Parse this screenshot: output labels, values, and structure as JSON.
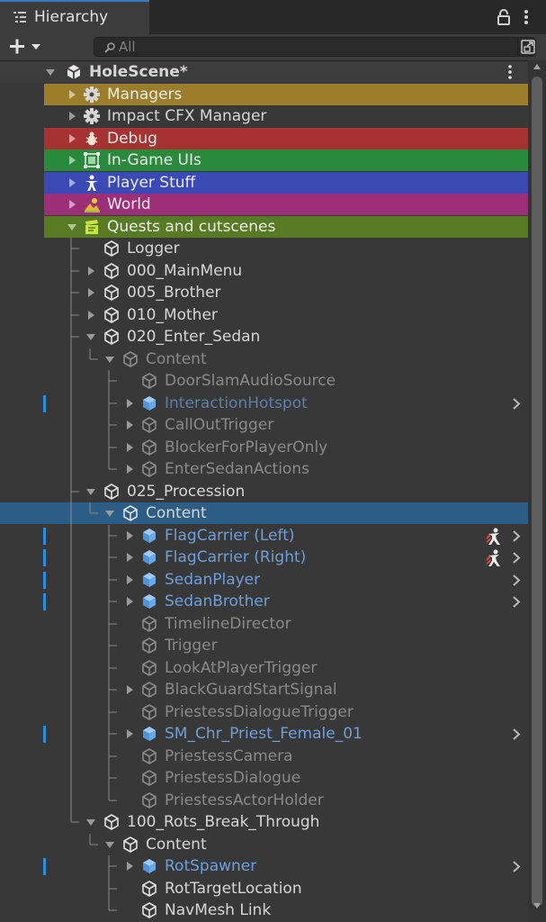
{
  "tab": {
    "title": "Hierarchy",
    "icon": "hierarchy-list-icon"
  },
  "toolbar": {
    "create_icon": "plus-icon",
    "search_placeholder": "All",
    "search_value": ""
  },
  "colors": {
    "selection": "#2c5d87",
    "managers": "#9c7d29",
    "debug": "#a63232",
    "ingame": "#2a8a3c",
    "player": "#3a49b4",
    "world": "#9d2e78",
    "quests": "#577a22",
    "prefab_text": "#6e9fdc",
    "inactive_text": "#8a8a8a",
    "prefab_bar": "#2c8ed8"
  },
  "rows": [
    {
      "name": "HoleScene*",
      "depth": 0,
      "expanded": true,
      "kind": "scene",
      "bold": true
    },
    {
      "name": "Managers",
      "depth": 1,
      "expanded": false,
      "icon": "gear-icon",
      "color": "managers"
    },
    {
      "name": "Impact CFX Manager",
      "depth": 1,
      "expanded": false,
      "icon": "gear-icon"
    },
    {
      "name": "Debug",
      "depth": 1,
      "expanded": false,
      "icon": "bug-icon",
      "color": "debug"
    },
    {
      "name": "In-Game UIs",
      "depth": 1,
      "expanded": false,
      "icon": "ui-frame-icon",
      "color": "ingame"
    },
    {
      "name": "Player Stuff",
      "depth": 1,
      "expanded": false,
      "icon": "person-icon",
      "color": "player"
    },
    {
      "name": "World",
      "depth": 1,
      "expanded": false,
      "icon": "terrain-icon",
      "color": "world"
    },
    {
      "name": "Quests and cutscenes",
      "depth": 1,
      "expanded": true,
      "icon": "clapperboard-icon",
      "color": "quests"
    },
    {
      "name": "Logger",
      "depth": 2,
      "kind": "go"
    },
    {
      "name": "000_MainMenu",
      "depth": 2,
      "expanded": false,
      "kind": "go"
    },
    {
      "name": "005_Brother",
      "depth": 2,
      "expanded": false,
      "kind": "go"
    },
    {
      "name": "010_Mother",
      "depth": 2,
      "expanded": false,
      "kind": "go"
    },
    {
      "name": "020_Enter_Sedan",
      "depth": 2,
      "expanded": true,
      "kind": "go"
    },
    {
      "name": "Content",
      "depth": 3,
      "expanded": true,
      "kind": "go",
      "inactive": true
    },
    {
      "name": "DoorSlamAudioSource",
      "depth": 4,
      "kind": "go",
      "inactive": true
    },
    {
      "name": "InteractionHotspot",
      "depth": 4,
      "expanded": false,
      "kind": "prefab",
      "inactive": true
    },
    {
      "name": "CallOutTrigger",
      "depth": 4,
      "expanded": false,
      "kind": "go",
      "inactive": true
    },
    {
      "name": "BlockerForPlayerOnly",
      "depth": 4,
      "expanded": false,
      "kind": "go",
      "inactive": true
    },
    {
      "name": "EnterSedanActions",
      "depth": 4,
      "expanded": false,
      "kind": "go",
      "inactive": true
    },
    {
      "name": "025_Procession",
      "depth": 2,
      "expanded": true,
      "kind": "go"
    },
    {
      "name": "Content",
      "depth": 3,
      "expanded": true,
      "kind": "go",
      "selected": true
    },
    {
      "name": "FlagCarrier (Left)",
      "depth": 4,
      "expanded": false,
      "kind": "prefab",
      "timeline": true
    },
    {
      "name": "FlagCarrier (Right)",
      "depth": 4,
      "expanded": false,
      "kind": "prefab",
      "timeline": true
    },
    {
      "name": "SedanPlayer",
      "depth": 4,
      "expanded": false,
      "kind": "prefab"
    },
    {
      "name": "SedanBrother",
      "depth": 4,
      "expanded": false,
      "kind": "prefab"
    },
    {
      "name": "TimelineDirector",
      "depth": 4,
      "kind": "go",
      "inactive": true
    },
    {
      "name": "Trigger",
      "depth": 4,
      "kind": "go",
      "inactive": true
    },
    {
      "name": "LookAtPlayerTrigger",
      "depth": 4,
      "kind": "go",
      "inactive": true
    },
    {
      "name": "BlackGuardStartSignal",
      "depth": 4,
      "expanded": false,
      "kind": "go",
      "inactive": true
    },
    {
      "name": "PriestessDialogueTrigger",
      "depth": 4,
      "kind": "go",
      "inactive": true
    },
    {
      "name": "SM_Chr_Priest_Female_01",
      "depth": 4,
      "expanded": false,
      "kind": "prefab"
    },
    {
      "name": "PriestessCamera",
      "depth": 4,
      "kind": "go",
      "inactive": true
    },
    {
      "name": "PriestessDialogue",
      "depth": 4,
      "kind": "go",
      "inactive": true
    },
    {
      "name": "PriestessActorHolder",
      "depth": 4,
      "kind": "go",
      "inactive": true
    },
    {
      "name": "100_Rots_Break_Through",
      "depth": 2,
      "expanded": true,
      "kind": "go"
    },
    {
      "name": "Content",
      "depth": 3,
      "expanded": true,
      "kind": "go"
    },
    {
      "name": "RotSpawner",
      "depth": 4,
      "expanded": false,
      "kind": "prefab"
    },
    {
      "name": "RotTargetLocation",
      "depth": 4,
      "kind": "go"
    },
    {
      "name": "NavMesh Link",
      "depth": 4,
      "kind": "go"
    }
  ]
}
